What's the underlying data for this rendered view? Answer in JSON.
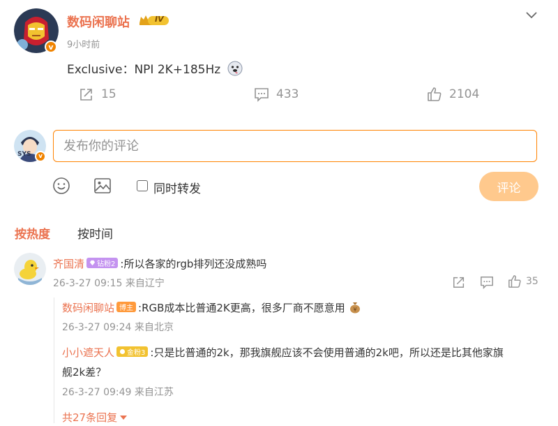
{
  "post": {
    "author": "数码闲聊站",
    "level_badge": "IV",
    "verified_mark": "v",
    "time": "9小时前",
    "text": "Exclusive：NPI 2K+185Hz",
    "emoji": "dog-face-emoji",
    "actions": {
      "repost_count": "15",
      "comment_count": "433",
      "like_count": "2104"
    }
  },
  "composer": {
    "avatar_text": "SYS",
    "placeholder": "发布你的评论",
    "forward_label": "同时转发",
    "submit_label": "评论"
  },
  "tabs": {
    "hot": "按热度",
    "time": "按时间"
  },
  "comment": {
    "user": "齐国清",
    "badge": "钻粉2",
    "text": ":所以各家的rgb排列还没成熟吗",
    "meta": "26-3-27 09:15 来自辽宁",
    "like_count": "35",
    "replies": [
      {
        "user": "数码闲聊站",
        "badge": "博主",
        "text": ":RGB成本比普通2K更高，很多厂商不愿意用",
        "meta": "26-3-27 09:24 来自北京"
      },
      {
        "user": "小小遮天人",
        "badge": "金粉3",
        "text_line1": ":只是比普通的2k，那我旗舰应该不会使用普通的2k吧，所以还是比其他家旗",
        "text_line2": "舰2k差？",
        "meta": "26-3-27 09:49 来自江苏"
      }
    ],
    "more_replies": "共27条回复"
  },
  "colors": {
    "accent": "#eb7350",
    "brand_orange": "#ff8200",
    "submit_disabled": "#ffc98d",
    "gray_text": "#939393"
  }
}
